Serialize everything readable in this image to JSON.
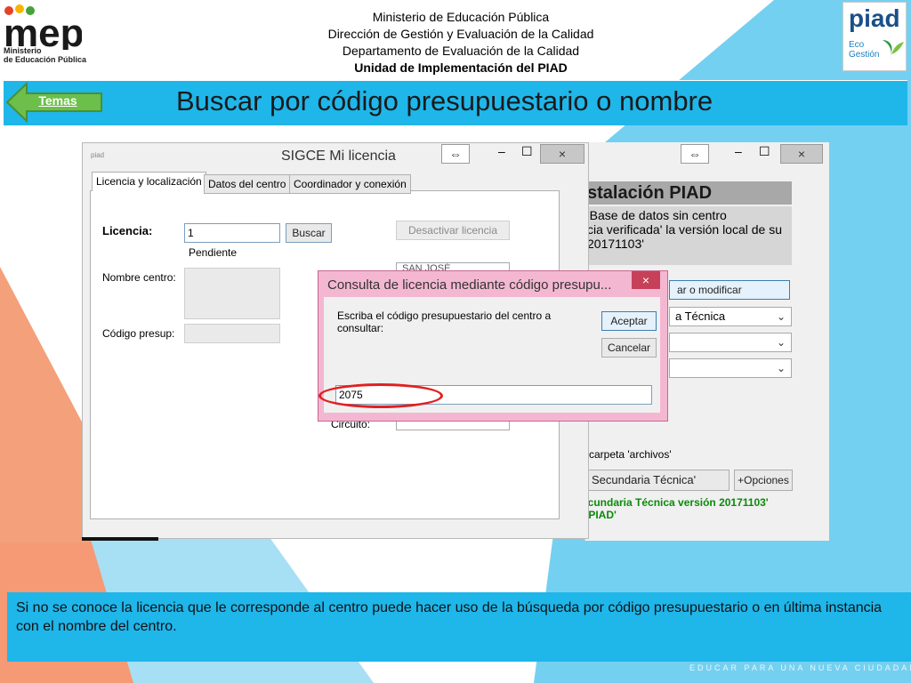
{
  "header": {
    "lines": [
      "Ministerio de Educación Pública",
      "Dirección de Gestión y Evaluación de la Calidad",
      "Departamento de Evaluación de la Calidad",
      "Unidad de Implementación del PIAD"
    ],
    "mep_logo_text": "mep",
    "mep_logo_sub": [
      "Ministerio",
      "de Educación Pública"
    ],
    "piad_logo_text": "piad",
    "piad_logo_sub": [
      "Eco",
      "Gestión"
    ]
  },
  "title": "Buscar por código presupuestario o nombre",
  "back_button": {
    "label": "Temas"
  },
  "left_window": {
    "title": "SIGCE Mi licencia",
    "icon_text": "piad",
    "title_buttons": [
      "⇔",
      "–",
      "☐",
      "×"
    ],
    "tabs": [
      "Licencia y localización",
      "Datos del centro",
      "Coordinador y conexión"
    ],
    "licencia_label": "Licencia:",
    "licencia_value": "1",
    "buscar_button": "Buscar",
    "estado": "Pendiente",
    "desactivar_button": "Desactivar licencia",
    "nombre_label": "Nombre centro:",
    "codigo_label": "Código presup:",
    "provincia_value": "SAN JOSÉ",
    "circuito_label": "Circuito:"
  },
  "right_window": {
    "title_buttons": [
      "⇔",
      "–",
      "☐",
      "×"
    ],
    "heading": "stalación PIAD",
    "message": [
      "'Base de datos sin centro",
      "cia verificada' la versión local de su",
      "20171103'"
    ],
    "action_button": "ar o modificar",
    "select1": "a Técnica",
    "carpeta_text": "carpeta 'archivos'",
    "secundaria_button": "Secundaria Técnica'",
    "opciones_button": "+Opciones",
    "status_lines": [
      "ecundaria Técnica versión 20171103'",
      "t\\PIAD'"
    ]
  },
  "dialog": {
    "title": "Consulta de licencia mediante código presupu...",
    "close": "×",
    "prompt": "Escriba el código presupuestario del centro a consultar:",
    "accept": "Aceptar",
    "cancel": "Cancelar",
    "input_value": "2075"
  },
  "footer": {
    "text": "Si no se conoce la licencia que le corresponde al centro puede hacer uso de la búsqueda por código presupuestario o en última instancia con el nombre del centro.",
    "tagline": "EDUCAR PARA UNA NUEVA CIUDADANÍA"
  },
  "colors": {
    "banner": "#1fb6ea",
    "light_blue_bg": "#74d0f1",
    "orange": "#f4a07a",
    "dialog_border": "#f4b7d2",
    "back_arrow": "#6bbf4a",
    "status_green": "#0a8a0a"
  }
}
